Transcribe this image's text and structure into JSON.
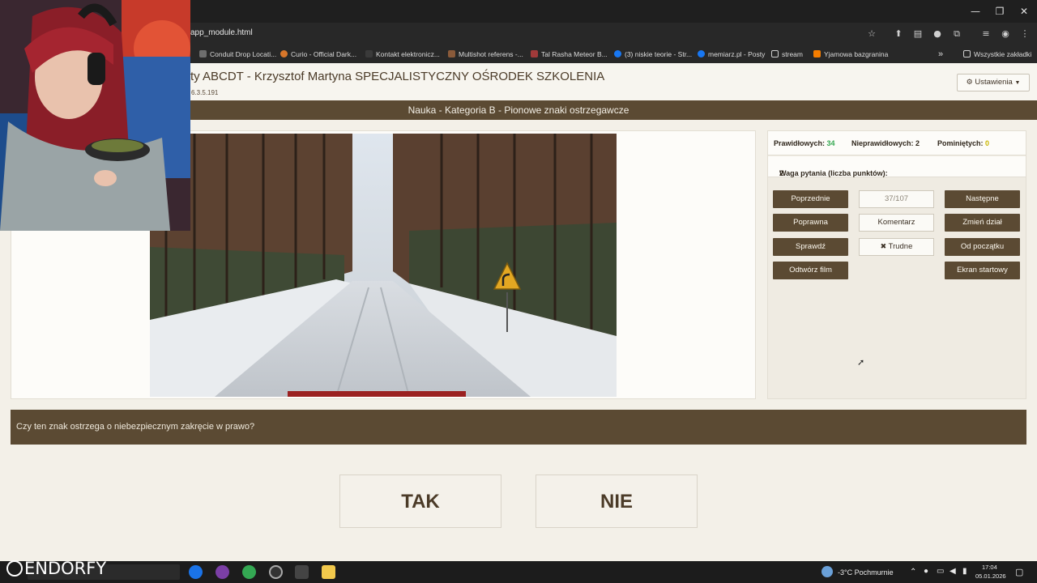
{
  "browser": {
    "url": "app_module.html",
    "bookmarks": [
      {
        "label": "Conduit Drop Locati...",
        "icon": "bookmark-icon"
      },
      {
        "label": "Curio - Official Dark...",
        "icon": "curio-icon"
      },
      {
        "label": "Kontakt elektronicz...",
        "icon": "site-icon"
      },
      {
        "label": "Multishot referens -...",
        "icon": "site-icon"
      },
      {
        "label": "Tal Rasha Meteor B...",
        "icon": "site-icon"
      },
      {
        "label": "(3) niskie teorie - Str...",
        "icon": "facebook-icon"
      },
      {
        "label": "memiarz.pl - Posty",
        "icon": "facebook-icon"
      },
      {
        "label": "stream",
        "icon": "folder-icon"
      },
      {
        "label": "Yjamowa bazgranina",
        "icon": "blogger-icon"
      }
    ],
    "more_bookmarks": "»",
    "all_bookmarks": "Wszystkie zakładki",
    "window_controls": {
      "minimize": "—",
      "restore": "❐",
      "close": "✕"
    }
  },
  "header": {
    "title": "ty ABCDT - Krzysztof Martyna SPECJALISTYCZNY OŚRODEK SZKOLENIA",
    "version": "6.3.5.191",
    "settings_label": "Ustawienia"
  },
  "section": {
    "title": "Nauka - Kategoria B - Pionowe znaki ostrzegawcze"
  },
  "stats": {
    "correct_label": "Prawidłowych:",
    "correct_value": "34",
    "incorrect_label": "Nieprawidłowych:",
    "incorrect_value": "2",
    "skipped_label": "Pominiętych:",
    "skipped_value": "0",
    "weight_label": "Waga pytania (liczba punktów):",
    "weight_value": "2"
  },
  "controls": {
    "previous": "Poprzednie",
    "counter": "37/107",
    "next": "Następne",
    "correct": "Poprawna",
    "comment": "Komentarz",
    "change_section": "Zmień dział",
    "check": "Sprawdź",
    "hard": "Trudne",
    "from_start": "Od początku",
    "play_film": "Odtwórz film",
    "start_screen": "Ekran startowy"
  },
  "question": {
    "text": "Czy ten znak ostrzega o niebezpiecznym zakręcie w prawo?"
  },
  "answers": {
    "yes": "TAK",
    "no": "NIE"
  },
  "taskbar": {
    "weather": "-3°C  Pochmurnie",
    "time": "17:04",
    "date": "05.01.2026"
  },
  "overlay": {
    "watermark": "ENDORFY"
  },
  "colors": {
    "brand_brown": "#5b4a33",
    "correct_green": "#35a852",
    "skipped_yellow": "#c9b600",
    "page_background": "#f3f0e8"
  }
}
